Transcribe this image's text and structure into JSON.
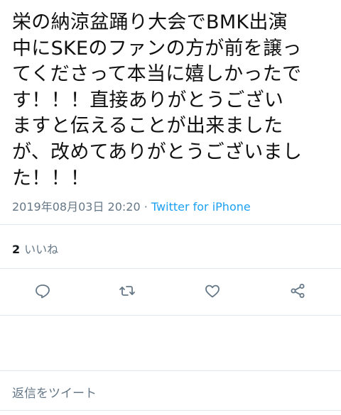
{
  "tweet": {
    "lines": [
      "栄の納涼盆踊り大会でBMK出演",
      "中にSKEのファンの方が前を譲っ",
      "てくださって本当に嬉しかったで",
      "す！！！直接ありがとうござい",
      "ますと伝えることが出来ました",
      "が、改めてありがとうございまし",
      "た！！！"
    ],
    "timestamp": "2019年08月03日 20:20",
    "separator": " · ",
    "source": "Twitter for iPhone",
    "likes_count": "2",
    "likes_label": "いいね"
  },
  "actions": {
    "reply_icon": "reply-icon",
    "retweet_icon": "retweet-icon",
    "like_icon": "like-icon",
    "share_icon": "share-icon"
  },
  "reply_bar": {
    "placeholder": "返信をツイート"
  },
  "colors": {
    "text": "#111111",
    "muted": "#657786",
    "link": "#1da1f2",
    "divider": "#e1e8ed"
  }
}
